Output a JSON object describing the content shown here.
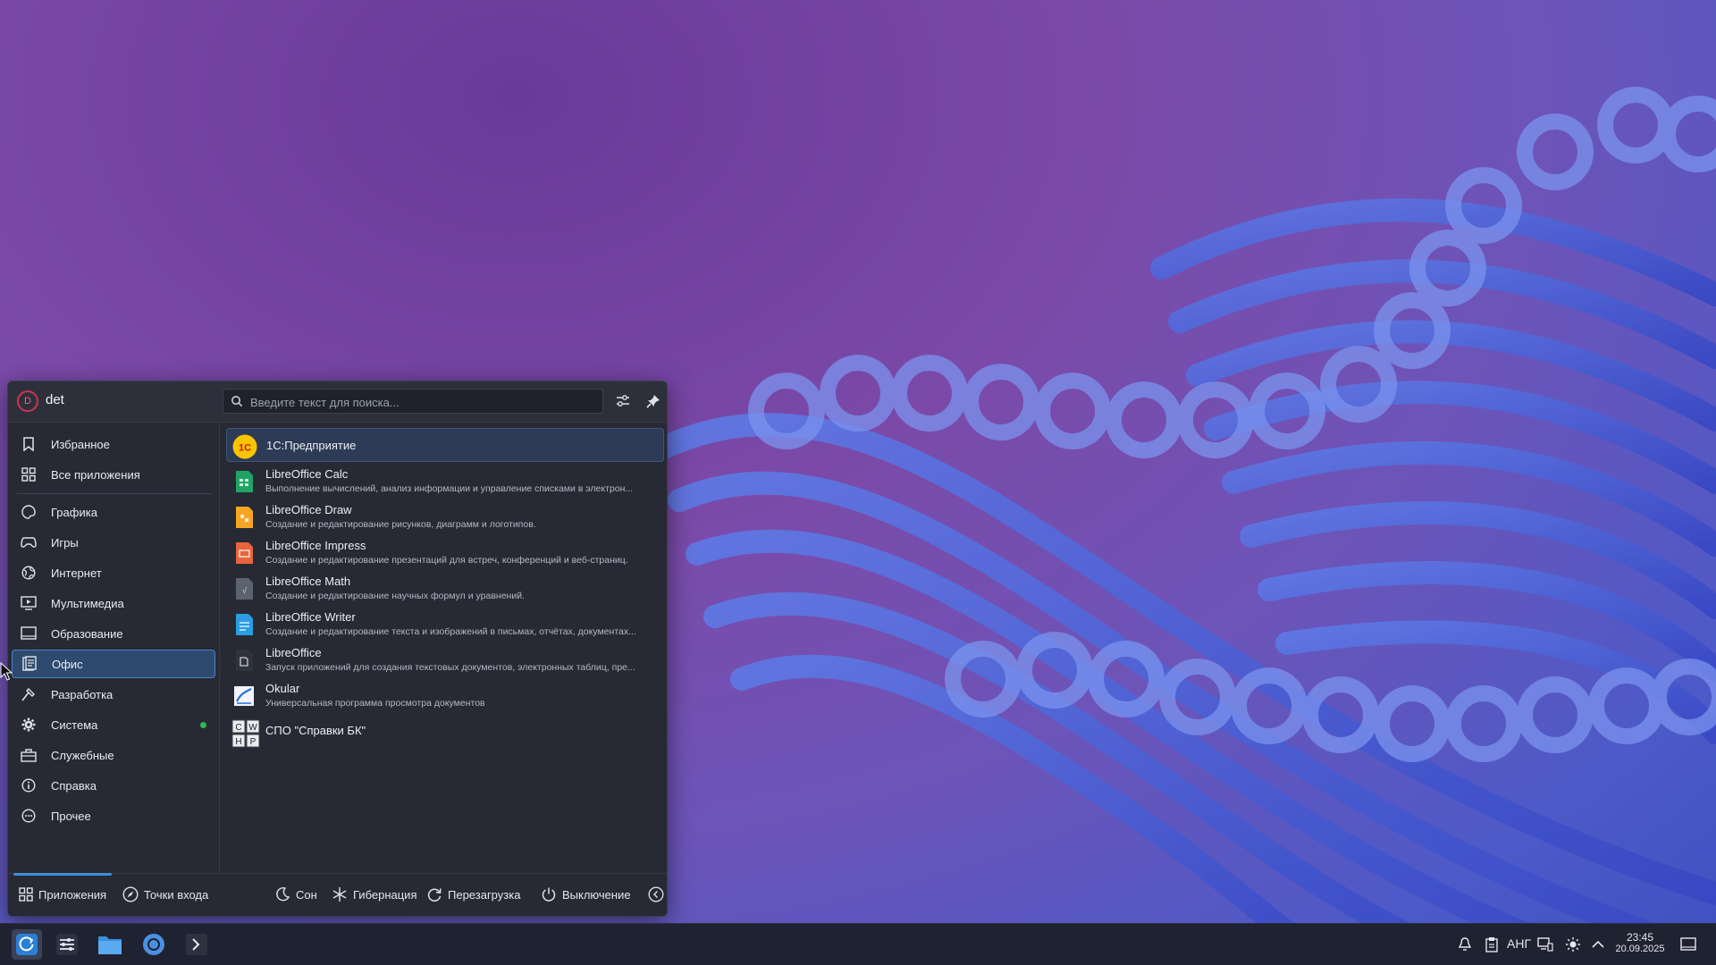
{
  "header": {
    "avatar_initial": "D",
    "username": "det",
    "search_placeholder": "Введите текст для поиска..."
  },
  "sidebar": {
    "items": [
      {
        "label": "Избранное",
        "icon": "bookmark-icon"
      },
      {
        "label": "Все приложения",
        "icon": "grid-icon"
      },
      {
        "label": "Графика",
        "icon": "palette-icon"
      },
      {
        "label": "Игры",
        "icon": "gamepad-icon"
      },
      {
        "label": "Интернет",
        "icon": "globe-icon"
      },
      {
        "label": "Мультимедиа",
        "icon": "monitor-play-icon"
      },
      {
        "label": "Образование",
        "icon": "book-icon"
      },
      {
        "label": "Офис",
        "icon": "office-doc-icon",
        "active": true
      },
      {
        "label": "Разработка",
        "icon": "hammer-icon"
      },
      {
        "label": "Система",
        "icon": "gear-icon",
        "badge": "green-dot"
      },
      {
        "label": "Служебные",
        "icon": "toolbox-icon"
      },
      {
        "label": "Справка",
        "icon": "info-icon"
      },
      {
        "label": "Прочее",
        "icon": "more-circle-icon"
      }
    ]
  },
  "apps": [
    {
      "name": "1С:Предприятие",
      "desc": "",
      "icon": "1c-icon",
      "active": true
    },
    {
      "name": "LibreOffice Calc",
      "desc": "Выполнение вычислений, анализ информации и управление списками в электрон...",
      "icon": "calc-icon"
    },
    {
      "name": "LibreOffice Draw",
      "desc": "Создание и редактирование рисунков, диаграмм и логотипов.",
      "icon": "draw-icon"
    },
    {
      "name": "LibreOffice Impress",
      "desc": "Создание и редактирование презентаций для встреч, конференций и веб-страниц.",
      "icon": "impress-icon"
    },
    {
      "name": "LibreOffice Math",
      "desc": "Создание и редактирование научных формул и уравнений.",
      "icon": "math-icon"
    },
    {
      "name": "LibreOffice Writer",
      "desc": "Создание и редактирование текста и изображений в письмах, отчётах, документах...",
      "icon": "writer-icon"
    },
    {
      "name": "LibreOffice",
      "desc": "Запуск приложений для создания текстовых документов, электронных таблиц, пре...",
      "icon": "libreoffice-icon"
    },
    {
      "name": "Okular",
      "desc": "Универсальная программа просмотра документов",
      "icon": "okular-icon"
    },
    {
      "name": "СПО \"Справки БК\"",
      "desc": "",
      "icon": "spravki-bk-icon"
    }
  ],
  "footer": {
    "apps_tab": "Приложения",
    "places_tab": "Точки входа",
    "sleep": "Сон",
    "hibernate": "Гибернация",
    "restart": "Перезагрузка",
    "shutdown": "Выключение"
  },
  "taskbar": {
    "language": "АНГ",
    "time": "23:45",
    "date": "20.09.2025"
  },
  "colors": {
    "accent": "#3d8fd8",
    "menu_bg": "#272a34",
    "active_item": "#2e4a6e",
    "status_green": "#2eb84d"
  }
}
